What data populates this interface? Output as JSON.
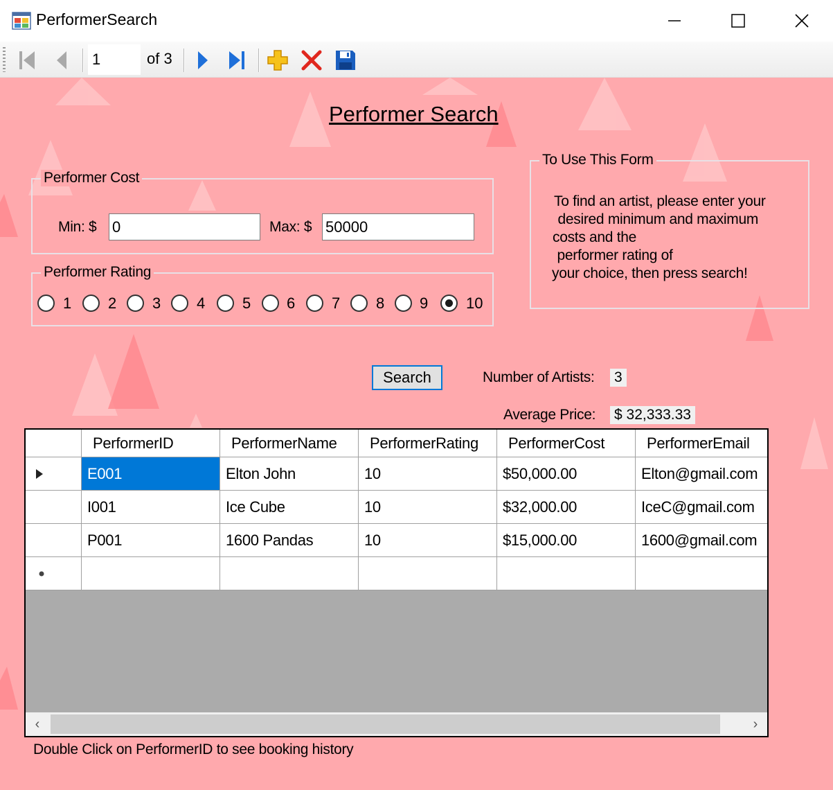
{
  "window": {
    "title": "PerformerSearch"
  },
  "navigator": {
    "position": "1",
    "of_label": "of 3"
  },
  "form": {
    "title": "Performer Search",
    "cost_group": {
      "label": "Performer Cost",
      "min_label": "Min: $",
      "min_value": "0",
      "max_label": "Max: $",
      "max_value": "50000"
    },
    "rating_group": {
      "label": "Performer Rating",
      "options": [
        "1",
        "2",
        "3",
        "4",
        "5",
        "6",
        "7",
        "8",
        "9",
        "10"
      ],
      "selected": "10"
    },
    "help_group": {
      "label": "To Use This Form",
      "lines": [
        "To find an artist, please enter your",
        " desired minimum and maximum",
        "costs and the",
        " performer rating of",
        "your choice, then press search!"
      ]
    },
    "search_label": "Search",
    "artists_label": "Number of Artists:",
    "artists_value": "3",
    "avg_label": "Average Price:",
    "avg_value": "$ 32,333.33"
  },
  "grid": {
    "columns": [
      "PerformerID",
      "PerformerName",
      "PerformerRating",
      "PerformerCost",
      "PerformerEmail"
    ],
    "rows": [
      [
        "E001",
        "Elton John",
        "10",
        "$50,000.00",
        "Elton@gmail.com"
      ],
      [
        "I001",
        "Ice Cube",
        "10",
        "$32,000.00",
        "IceC@gmail.com"
      ],
      [
        "P001",
        "1600 Pandas",
        "10",
        "$15,000.00",
        "1600@gmail.com"
      ]
    ],
    "selected_row": 0,
    "selected_col": 0
  },
  "hint": "Double Click on PerformerID to see booking history",
  "colors": {
    "background": "#ffa9ad",
    "selection": "#0078d7",
    "accent": "#0078d7"
  }
}
